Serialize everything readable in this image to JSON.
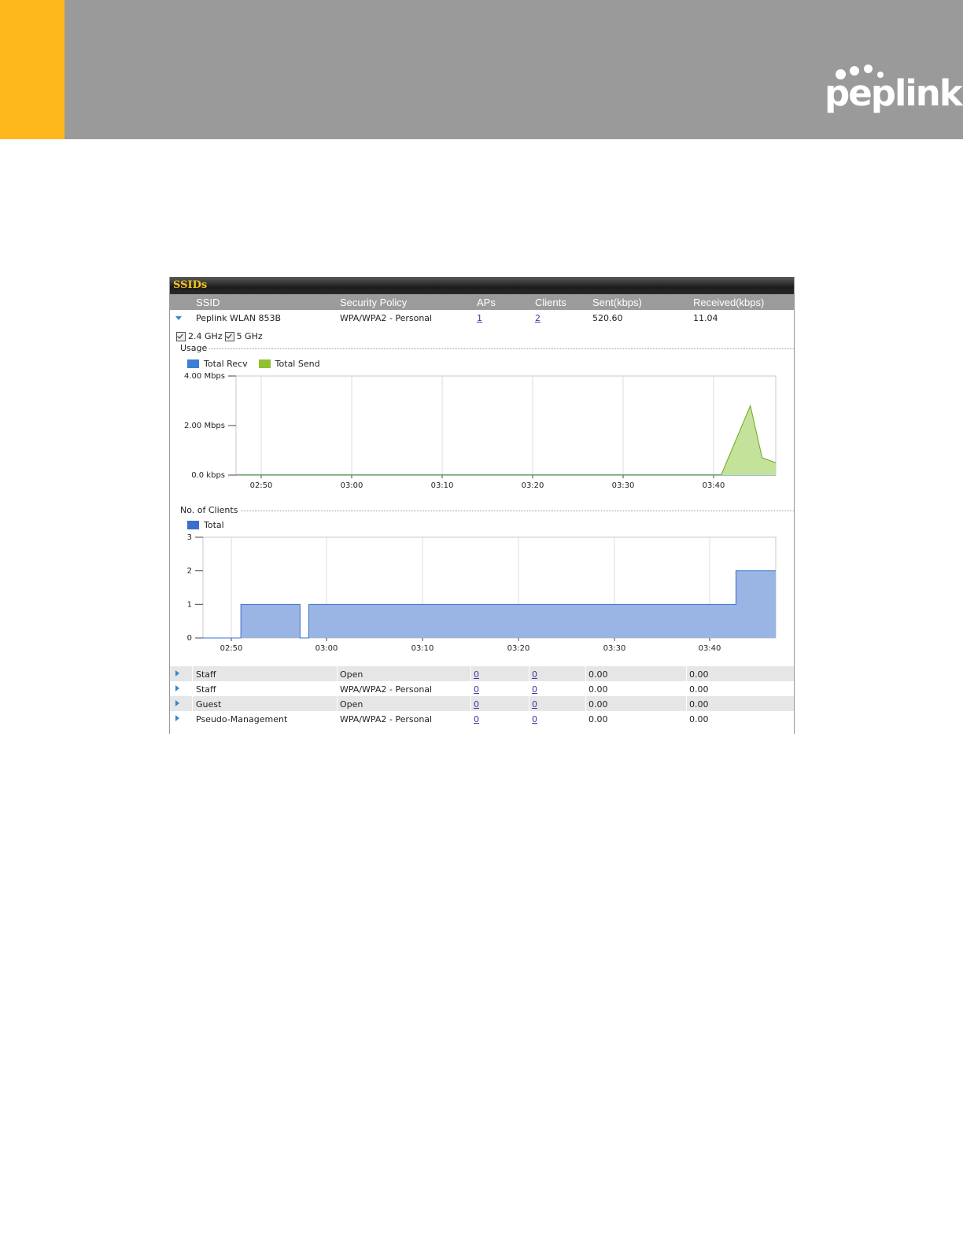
{
  "brand": {
    "logo_text": "peplink",
    "accent_color": "#ffb81c",
    "header_color": "#9a9a9a"
  },
  "panel": {
    "title": "SSIDs",
    "columns": [
      "SSID",
      "Security Policy",
      "APs",
      "Clients",
      "Sent(kbps)",
      "Received(kbps)"
    ],
    "expanded": {
      "ssid": "Peplink WLAN 853B",
      "security": "WPA/WPA2 - Personal",
      "aps": "1",
      "clients": "2",
      "sent": "520.60",
      "received": "11.04"
    },
    "bands": [
      {
        "label": "2.4 GHz",
        "checked": true
      },
      {
        "label": "5 GHz",
        "checked": true
      }
    ],
    "usage_label": "Usage",
    "clients_label": "No. of Clients",
    "rows": [
      {
        "ssid": "Staff",
        "security": "Open",
        "aps": "0",
        "clients": "0",
        "sent": "0.00",
        "received": "0.00"
      },
      {
        "ssid": "Staff",
        "security": "WPA/WPA2 - Personal",
        "aps": "0",
        "clients": "0",
        "sent": "0.00",
        "received": "0.00"
      },
      {
        "ssid": "Guest",
        "security": "Open",
        "aps": "0",
        "clients": "0",
        "sent": "0.00",
        "received": "0.00"
      },
      {
        "ssid": "Pseudo-Management",
        "security": "WPA/WPA2 - Personal",
        "aps": "0",
        "clients": "0",
        "sent": "0.00",
        "received": "0.00"
      }
    ]
  },
  "chart_data": [
    {
      "type": "area",
      "title": "Usage",
      "legend": [
        {
          "name": "Total Recv",
          "color": "#3c7fd4"
        },
        {
          "name": "Total Send",
          "color": "#8fc130"
        }
      ],
      "y_ticks": [
        "4.00 Mbps",
        "2.00 Mbps",
        "0.0 kbps"
      ],
      "x_ticks": [
        "02:50",
        "03:00",
        "03:10",
        "03:20",
        "03:30",
        "03:40"
      ],
      "ylim": [
        0,
        4.0
      ],
      "x_range_min": [
        47,
        106.5
      ],
      "series": [
        {
          "name": "Total Recv",
          "points": [
            [
              47,
              0
            ],
            [
              106.5,
              0
            ]
          ]
        },
        {
          "name": "Total Send",
          "points": [
            [
              47,
              0.02
            ],
            [
              100.5,
              0.02
            ],
            [
              103.7,
              2.8
            ],
            [
              105,
              0.7
            ],
            [
              106.5,
              0.5
            ]
          ]
        }
      ]
    },
    {
      "type": "area",
      "title": "No. of Clients",
      "legend": [
        {
          "name": "Total",
          "color": "#3c6fcc"
        }
      ],
      "y_ticks": [
        "3",
        "2",
        "1",
        "0"
      ],
      "x_ticks": [
        "02:50",
        "03:00",
        "03:10",
        "03:20",
        "03:30",
        "03:40"
      ],
      "ylim": [
        0,
        3
      ],
      "x_range_min": [
        47,
        106
      ],
      "series": [
        {
          "name": "Total",
          "points": [
            [
              47,
              0
            ],
            [
              50.9,
              0
            ],
            [
              50.9,
              1
            ],
            [
              57,
              1
            ],
            [
              57,
              0
            ],
            [
              57.9,
              0
            ],
            [
              57.9,
              1
            ],
            [
              101.9,
              1
            ],
            [
              101.9,
              2
            ],
            [
              106,
              2
            ]
          ]
        }
      ]
    }
  ]
}
